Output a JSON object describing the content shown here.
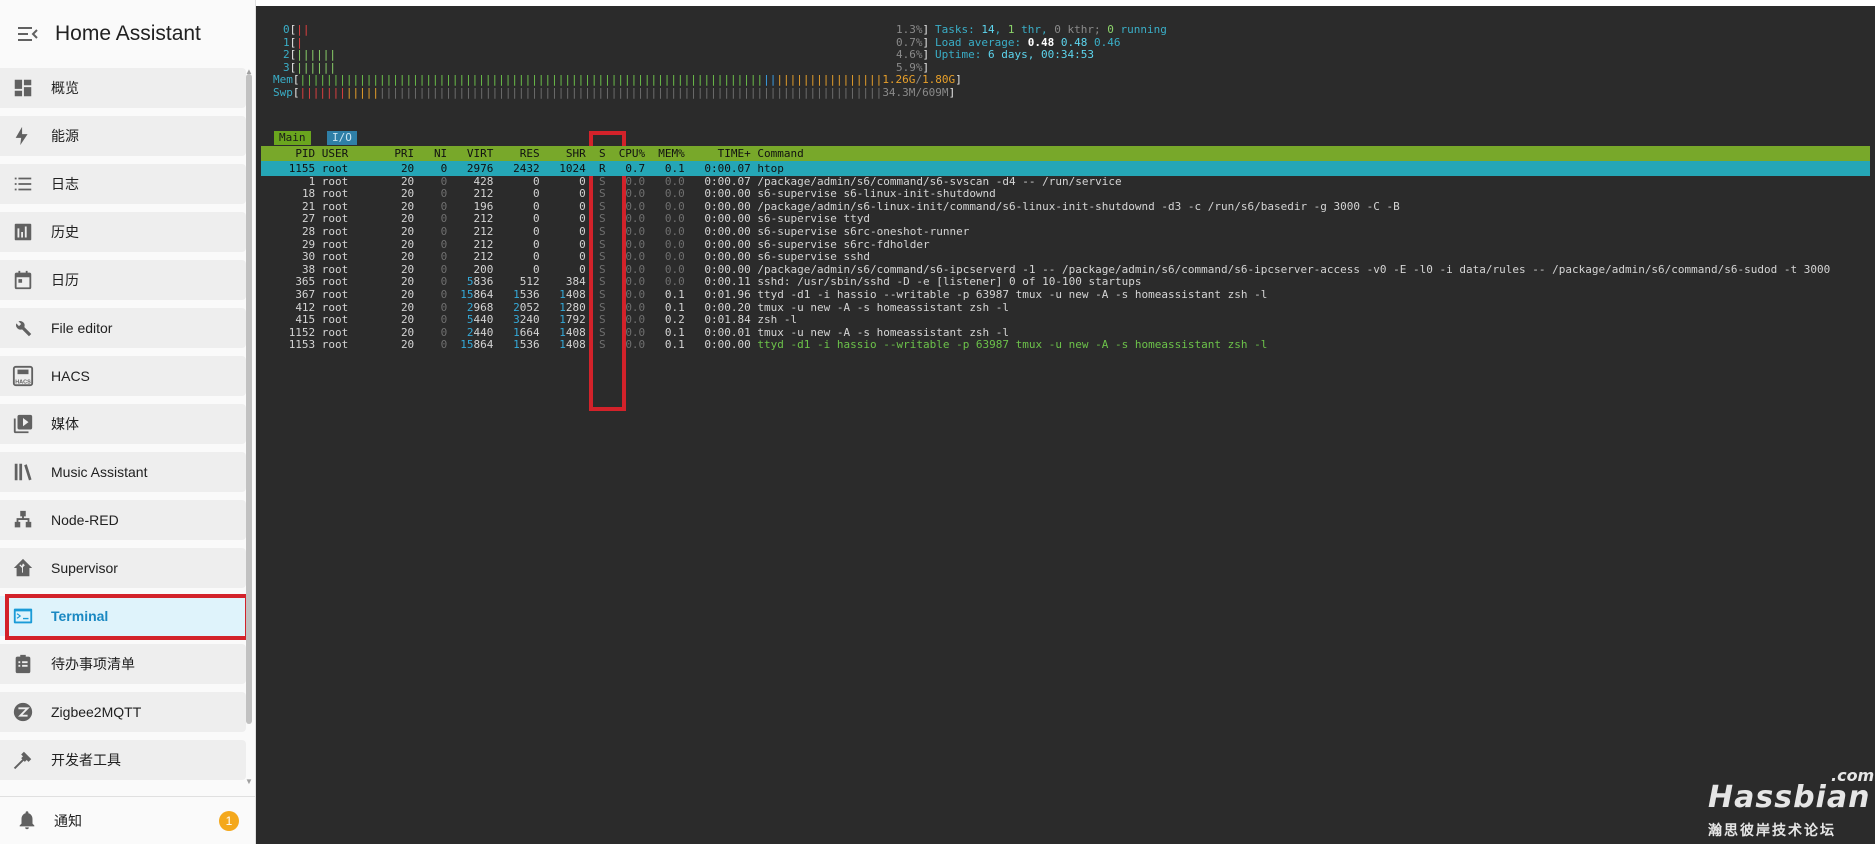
{
  "app": {
    "title": "Home Assistant"
  },
  "sidebar": {
    "items": [
      {
        "label": "概览",
        "icon": "dashboard-icon"
      },
      {
        "label": "能源",
        "icon": "lightning-bolt-icon"
      },
      {
        "label": "日志",
        "icon": "list-icon"
      },
      {
        "label": "历史",
        "icon": "chart-box-icon"
      },
      {
        "label": "日历",
        "icon": "calendar-icon"
      },
      {
        "label": "File editor",
        "icon": "wrench-icon"
      },
      {
        "label": "HACS",
        "icon": "hacs-icon",
        "icon_text": "HACS"
      },
      {
        "label": "媒体",
        "icon": "play-box-multiple-icon"
      },
      {
        "label": "Music Assistant",
        "icon": "bookshelf-icon"
      },
      {
        "label": "Node-RED",
        "icon": "sitemap-icon"
      },
      {
        "label": "Supervisor",
        "icon": "home-assistant-icon"
      },
      {
        "label": "Terminal",
        "icon": "console-icon",
        "active": true
      },
      {
        "label": "待办事项清单",
        "icon": "clipboard-list-icon"
      },
      {
        "label": "Zigbee2MQTT",
        "icon": "zigbee-icon"
      },
      {
        "label": "开发者工具",
        "icon": "hammer-icon"
      }
    ],
    "footer": {
      "label": "通知",
      "badge": "1",
      "icon": "bell-icon"
    }
  },
  "colors": {
    "accent": "#1a9bd7",
    "highlight_box": "#d3222a",
    "terminal_bg": "#2b2b2b",
    "header_bar": "#78a82a",
    "selected_row": "#25a6b6",
    "badge": "#f4a81c"
  },
  "htop": {
    "cpus": [
      {
        "id": "0",
        "bar": "||",
        "pct": "1.3%"
      },
      {
        "id": "1",
        "bar": "|",
        "pct": "0.7%"
      },
      {
        "id": "2",
        "bar": "||||||",
        "pct": "4.6%"
      },
      {
        "id": "3",
        "bar": "||||||",
        "pct": "5.9%"
      }
    ],
    "mem": {
      "label": "Mem",
      "used": "1.26G",
      "total": "1.80G"
    },
    "swp": {
      "label": "Swp",
      "used": "34.3M",
      "total": "609M"
    },
    "tasks": {
      "label": "Tasks:",
      "tasks": "14",
      "thr": "1",
      "thr_label": "thr,",
      "kthr": "0",
      "kthr_label": "kthr;",
      "running": "0",
      "running_label": "running"
    },
    "load": {
      "label": "Load average:",
      "v1": "0.48",
      "v5": "0.48",
      "v15": "0.46"
    },
    "uptime": {
      "label": "Uptime:",
      "value": "6 days, 00:34:53"
    },
    "tabs": [
      "Main",
      "I/O"
    ],
    "columns": [
      "PID",
      "USER",
      "PRI",
      "NI",
      "VIRT",
      "RES",
      "SHR",
      "S",
      "CPU%",
      "MEM%",
      "TIME+",
      "Command"
    ],
    "rows": [
      {
        "pid": "1155",
        "user": "root",
        "pri": "20",
        "ni": "0",
        "virt": "2976",
        "res": "2432",
        "shr": "1024",
        "s": "R",
        "cpu": "0.7",
        "mem": "0.1",
        "time": "0:00.07",
        "cmd": "htop",
        "selected": true
      },
      {
        "pid": "1",
        "user": "root",
        "pri": "20",
        "ni": "0",
        "virt": "428",
        "res": "0",
        "shr": "0",
        "s": "S",
        "cpu": "0.0",
        "mem": "0.0",
        "time": "0:00.07",
        "cmd": "/package/admin/s6/command/s6-svscan -d4 -- /run/service"
      },
      {
        "pid": "18",
        "user": "root",
        "pri": "20",
        "ni": "0",
        "virt": "212",
        "res": "0",
        "shr": "0",
        "s": "S",
        "cpu": "0.0",
        "mem": "0.0",
        "time": "0:00.00",
        "cmd": "s6-supervise s6-linux-init-shutdownd"
      },
      {
        "pid": "21",
        "user": "root",
        "pri": "20",
        "ni": "0",
        "virt": "196",
        "res": "0",
        "shr": "0",
        "s": "S",
        "cpu": "0.0",
        "mem": "0.0",
        "time": "0:00.00",
        "cmd": "/package/admin/s6-linux-init/command/s6-linux-init-shutdownd -d3 -c /run/s6/basedir -g 3000 -C -B"
      },
      {
        "pid": "27",
        "user": "root",
        "pri": "20",
        "ni": "0",
        "virt": "212",
        "res": "0",
        "shr": "0",
        "s": "S",
        "cpu": "0.0",
        "mem": "0.0",
        "time": "0:00.00",
        "cmd": "s6-supervise ttyd"
      },
      {
        "pid": "28",
        "user": "root",
        "pri": "20",
        "ni": "0",
        "virt": "212",
        "res": "0",
        "shr": "0",
        "s": "S",
        "cpu": "0.0",
        "mem": "0.0",
        "time": "0:00.00",
        "cmd": "s6-supervise s6rc-oneshot-runner"
      },
      {
        "pid": "29",
        "user": "root",
        "pri": "20",
        "ni": "0",
        "virt": "212",
        "res": "0",
        "shr": "0",
        "s": "S",
        "cpu": "0.0",
        "mem": "0.0",
        "time": "0:00.00",
        "cmd": "s6-supervise s6rc-fdholder"
      },
      {
        "pid": "30",
        "user": "root",
        "pri": "20",
        "ni": "0",
        "virt": "212",
        "res": "0",
        "shr": "0",
        "s": "S",
        "cpu": "0.0",
        "mem": "0.0",
        "time": "0:00.00",
        "cmd": "s6-supervise sshd"
      },
      {
        "pid": "38",
        "user": "root",
        "pri": "20",
        "ni": "0",
        "virt": "200",
        "res": "0",
        "shr": "0",
        "s": "S",
        "cpu": "0.0",
        "mem": "0.0",
        "time": "0:00.00",
        "cmd": "/package/admin/s6/command/s6-ipcserverd -1 -- /package/admin/s6/command/s6-ipcserver-access -v0 -E -l0 -i data/rules -- /package/admin/s6/command/s6-sudod -t 3000"
      },
      {
        "pid": "365",
        "user": "root",
        "pri": "20",
        "ni": "0",
        "virt": "5836",
        "res": "512",
        "shr": "384",
        "s": "S",
        "cpu": "0.0",
        "mem": "0.0",
        "time": "0:00.11",
        "cmd": "sshd: /usr/sbin/sshd -D -e [listener] 0 of 10-100 startups"
      },
      {
        "pid": "367",
        "user": "root",
        "pri": "20",
        "ni": "0",
        "virt": "15864",
        "res": "1536",
        "shr": "1408",
        "s": "S",
        "cpu": "0.0",
        "mem": "0.1",
        "time": "0:01.96",
        "cmd": "ttyd -d1 -i hassio --writable -p 63987 tmux -u new -A -s homeassistant zsh -l"
      },
      {
        "pid": "412",
        "user": "root",
        "pri": "20",
        "ni": "0",
        "virt": "2968",
        "res": "2052",
        "shr": "1280",
        "s": "S",
        "cpu": "0.0",
        "mem": "0.1",
        "time": "0:00.20",
        "cmd": "tmux -u new -A -s homeassistant zsh -l"
      },
      {
        "pid": "415",
        "user": "root",
        "pri": "20",
        "ni": "0",
        "virt": "5440",
        "res": "3240",
        "shr": "1792",
        "s": "S",
        "cpu": "0.0",
        "mem": "0.2",
        "time": "0:01.84",
        "cmd": "zsh -l"
      },
      {
        "pid": "1152",
        "user": "root",
        "pri": "20",
        "ni": "0",
        "virt": "2440",
        "res": "1664",
        "shr": "1408",
        "s": "S",
        "cpu": "0.0",
        "mem": "0.1",
        "time": "0:00.01",
        "cmd": "tmux -u new -A -s homeassistant zsh -l"
      },
      {
        "pid": "1153",
        "user": "root",
        "pri": "20",
        "ni": "0",
        "virt": "15864",
        "res": "1536",
        "shr": "1408",
        "s": "S",
        "cpu": "0.0",
        "mem": "0.1",
        "time": "0:00.00",
        "cmd": "ttyd -d1 -i hassio --writable -p 63987 tmux -u new -A -s homeassistant zsh -l",
        "thread": true
      }
    ]
  },
  "watermark": {
    "brand": "Hassbian",
    "suffix": ".com",
    "subtitle": "瀚思彼岸技术论坛"
  }
}
